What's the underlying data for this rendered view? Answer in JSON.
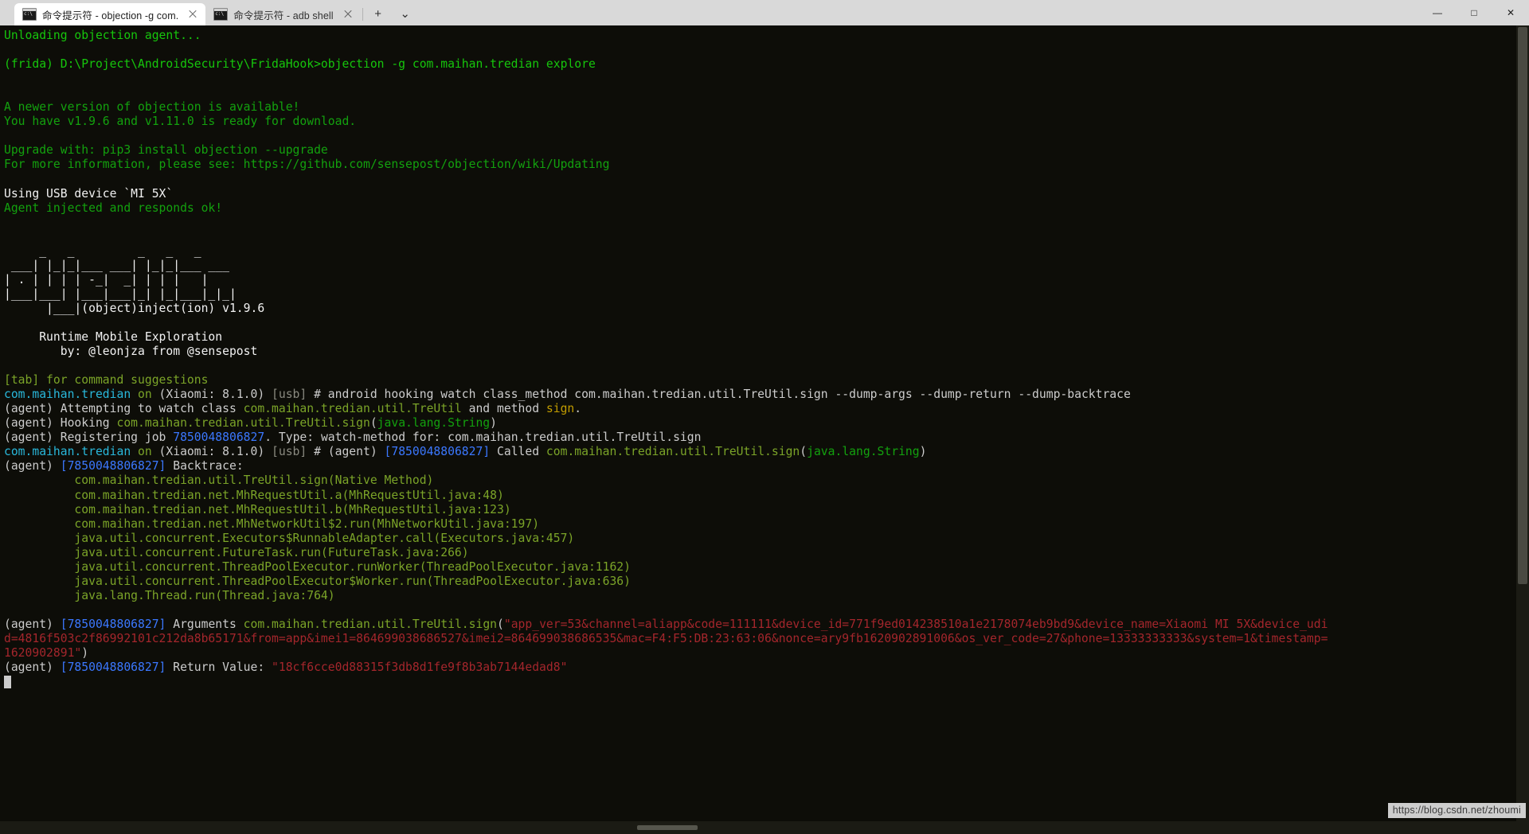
{
  "window": {
    "tabs": [
      {
        "icon": "console-icon",
        "label": "命令提示符 - objection  -g com.",
        "active": true,
        "close_label": "✕"
      },
      {
        "icon": "console-icon",
        "label": "命令提示符 - adb  shell",
        "active": false,
        "close_label": "✕"
      }
    ],
    "new_tab_label": "+",
    "tab_menu_label": "⌄",
    "controls": {
      "minimize": "—",
      "maximize": "□",
      "close": "✕"
    }
  },
  "watermark": {
    "text": "https://blog.csdn.net/zhoumi"
  },
  "colors": {
    "background": "#0d0d08",
    "foreground": "#cccccc",
    "green": "#13a10e",
    "bright_green": "#16c60c",
    "olive": "#7ba428",
    "cyan": "#3a96dd",
    "bright_cyan": "#29b8db",
    "orange": "#c19c00",
    "maroon": "#a4262c",
    "gray": "#8a8a80",
    "titlebar": "#d9d9d9"
  },
  "terminal": {
    "lines": [
      {
        "segments": [
          {
            "t": "Unloading objection agent...",
            "c": "c-brgreen"
          }
        ]
      },
      {
        "segments": []
      },
      {
        "segments": [
          {
            "t": "(frida) D:\\Project\\AndroidSecurity\\FridaHook>objection -g com.maihan.tredian explore",
            "c": "c-brgreen"
          }
        ]
      },
      {
        "segments": []
      },
      {
        "segments": []
      },
      {
        "segments": [
          {
            "t": "A newer version of objection is available!",
            "c": "c-green"
          }
        ]
      },
      {
        "segments": [
          {
            "t": "You have v1.9.6 and v1.11.0 is ready for download.",
            "c": "c-green"
          }
        ]
      },
      {
        "segments": []
      },
      {
        "segments": [
          {
            "t": "Upgrade with: pip3 install objection --upgrade",
            "c": "c-green"
          }
        ]
      },
      {
        "segments": [
          {
            "t": "For more information, please see: https://github.com/sensepost/objection/wiki/Updating",
            "c": "c-green"
          }
        ]
      },
      {
        "segments": []
      },
      {
        "segments": [
          {
            "t": "Using USB device `MI 5X`",
            "c": "c-brwhite"
          }
        ]
      },
      {
        "segments": [
          {
            "t": "Agent injected and responds ok!",
            "c": "c-green"
          }
        ]
      },
      {
        "segments": []
      },
      {
        "segments": []
      },
      {
        "segments": [
          {
            "t": "     _   _         _   _   _",
            "c": "c-brwhite"
          }
        ]
      },
      {
        "segments": [
          {
            "t": " ___| |_|_|___ ___| |_|_|___ ___",
            "c": "c-brwhite"
          }
        ]
      },
      {
        "segments": [
          {
            "t": "| . | | | | -_|  _| | | |   |",
            "c": "c-brwhite"
          }
        ]
      },
      {
        "segments": [
          {
            "t": "|___|___| |___|___|_| |_|___|_|_|",
            "c": "c-brwhite"
          }
        ]
      },
      {
        "segments": [
          {
            "t": "      |___|(object)inject(ion) v1.9.6",
            "c": "c-brwhite"
          }
        ]
      },
      {
        "segments": []
      },
      {
        "segments": [
          {
            "t": "     Runtime Mobile Exploration",
            "c": "c-brwhite"
          }
        ]
      },
      {
        "segments": [
          {
            "t": "        by: @leonjza from @sensepost",
            "c": "c-brwhite"
          }
        ]
      },
      {
        "segments": []
      },
      {
        "segments": [
          {
            "t": "[tab] for command suggestions",
            "c": "c-olive"
          }
        ]
      },
      {
        "segments": [
          {
            "t": "com.maihan.tredian",
            "c": "c-brcyan"
          },
          {
            "t": " ",
            "c": "c-white"
          },
          {
            "t": "on",
            "c": "c-olive"
          },
          {
            "t": " (Xiaomi: 8.1.0) ",
            "c": "c-white"
          },
          {
            "t": "[usb]",
            "c": "c-gray"
          },
          {
            "t": " # android hooking watch class_method com.maihan.tredian.util.TreUtil.sign --dump-args --dump-return --dump-backtrace",
            "c": "c-white"
          }
        ]
      },
      {
        "segments": [
          {
            "t": "(agent) Attempting to watch class ",
            "c": "c-white"
          },
          {
            "t": "com.maihan.tredian.util.TreUtil",
            "c": "c-olive"
          },
          {
            "t": " and method ",
            "c": "c-white"
          },
          {
            "t": "sign",
            "c": "c-orange"
          },
          {
            "t": ".",
            "c": "c-white"
          }
        ]
      },
      {
        "segments": [
          {
            "t": "(agent) Hooking ",
            "c": "c-white"
          },
          {
            "t": "com.maihan.tredian.util.TreUtil.sign",
            "c": "c-olive"
          },
          {
            "t": "(",
            "c": "c-white"
          },
          {
            "t": "java.lang.String",
            "c": "c-green"
          },
          {
            "t": ")",
            "c": "c-white"
          }
        ]
      },
      {
        "segments": [
          {
            "t": "(agent) Registering job ",
            "c": "c-white"
          },
          {
            "t": "7850048806827",
            "c": "c-blue"
          },
          {
            "t": ". Type: watch-method for: com.maihan.tredian.util.TreUtil.sign",
            "c": "c-white"
          }
        ]
      },
      {
        "segments": [
          {
            "t": "com.maihan.tredian",
            "c": "c-brcyan"
          },
          {
            "t": " ",
            "c": "c-white"
          },
          {
            "t": "on",
            "c": "c-olive"
          },
          {
            "t": " (Xiaomi: 8.1.0) ",
            "c": "c-white"
          },
          {
            "t": "[usb]",
            "c": "c-gray"
          },
          {
            "t": " # (agent) ",
            "c": "c-white"
          },
          {
            "t": "[7850048806827]",
            "c": "c-blue"
          },
          {
            "t": " Called ",
            "c": "c-white"
          },
          {
            "t": "com.maihan.tredian.util.TreUtil.sign",
            "c": "c-olive"
          },
          {
            "t": "(",
            "c": "c-white"
          },
          {
            "t": "java.lang.String",
            "c": "c-green"
          },
          {
            "t": ")",
            "c": "c-white"
          }
        ]
      },
      {
        "segments": [
          {
            "t": "(agent) ",
            "c": "c-white"
          },
          {
            "t": "[7850048806827]",
            "c": "c-blue"
          },
          {
            "t": " Backtrace:",
            "c": "c-white"
          }
        ]
      },
      {
        "segments": [
          {
            "t": "          com.maihan.tredian.util.TreUtil.sign(Native Method)",
            "c": "c-olive"
          }
        ]
      },
      {
        "segments": [
          {
            "t": "          com.maihan.tredian.net.MhRequestUtil.a(MhRequestUtil.java:48)",
            "c": "c-olive"
          }
        ]
      },
      {
        "segments": [
          {
            "t": "          com.maihan.tredian.net.MhRequestUtil.b(MhRequestUtil.java:123)",
            "c": "c-olive"
          }
        ]
      },
      {
        "segments": [
          {
            "t": "          com.maihan.tredian.net.MhNetworkUtil$2.run(MhNetworkUtil.java:197)",
            "c": "c-olive"
          }
        ]
      },
      {
        "segments": [
          {
            "t": "          java.util.concurrent.Executors$RunnableAdapter.call(Executors.java:457)",
            "c": "c-olive"
          }
        ]
      },
      {
        "segments": [
          {
            "t": "          java.util.concurrent.FutureTask.run(FutureTask.java:266)",
            "c": "c-olive"
          }
        ]
      },
      {
        "segments": [
          {
            "t": "          java.util.concurrent.ThreadPoolExecutor.runWorker(ThreadPoolExecutor.java:1162)",
            "c": "c-olive"
          }
        ]
      },
      {
        "segments": [
          {
            "t": "          java.util.concurrent.ThreadPoolExecutor$Worker.run(ThreadPoolExecutor.java:636)",
            "c": "c-olive"
          }
        ]
      },
      {
        "segments": [
          {
            "t": "          java.lang.Thread.run(Thread.java:764)",
            "c": "c-olive"
          }
        ]
      },
      {
        "segments": []
      },
      {
        "segments": [
          {
            "t": "(agent) ",
            "c": "c-white"
          },
          {
            "t": "[7850048806827]",
            "c": "c-blue"
          },
          {
            "t": " Arguments ",
            "c": "c-white"
          },
          {
            "t": "com.maihan.tredian.util.TreUtil.sign",
            "c": "c-olive"
          },
          {
            "t": "(",
            "c": "c-white"
          },
          {
            "t": "\"app_ver=53&channel=aliapp&code=111111&device_id=771f9ed014238510a1e2178074eb9bd9&device_name=Xiaomi MI 5X&device_udi",
            "c": "c-maroon"
          }
        ]
      },
      {
        "segments": [
          {
            "t": "d=4816f503c2f86992101c212da8b65171&from=app&imei1=864699038686527&imei2=864699038686535&mac=F4:F5:DB:23:63:06&nonce=ary9fb1620902891006&os_ver_code=27&phone=13333333333&system=1&timestamp=",
            "c": "c-maroon"
          }
        ]
      },
      {
        "segments": [
          {
            "t": "1620902891\"",
            "c": "c-maroon"
          },
          {
            "t": ")",
            "c": "c-white"
          }
        ]
      },
      {
        "segments": [
          {
            "t": "(agent) ",
            "c": "c-white"
          },
          {
            "t": "[7850048806827]",
            "c": "c-blue"
          },
          {
            "t": " Return Value: ",
            "c": "c-white"
          },
          {
            "t": "\"18cf6cce0d88315f3db8d1fe9f8b3ab7144edad8\"",
            "c": "c-maroon"
          }
        ]
      },
      {
        "segments": [
          {
            "t": "",
            "c": "c-white",
            "cursor": true
          }
        ]
      }
    ]
  }
}
